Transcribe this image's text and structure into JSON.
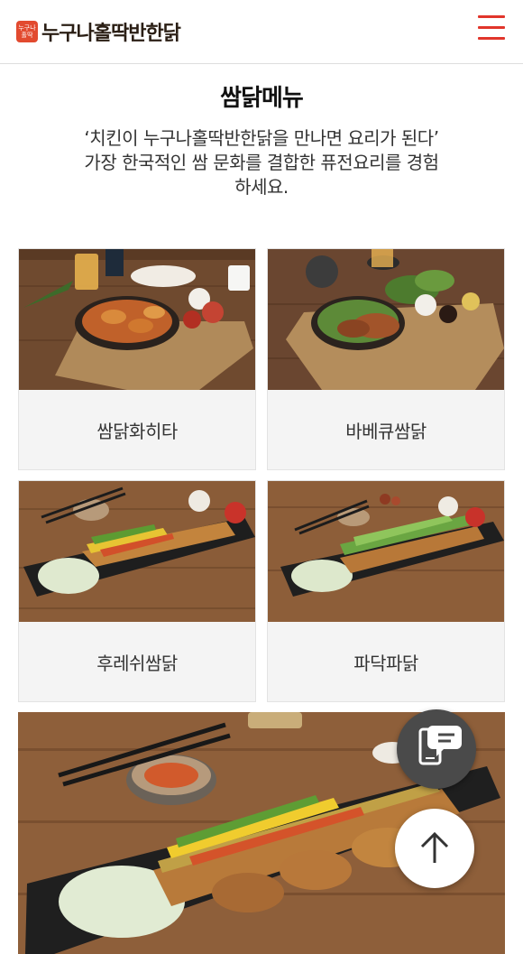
{
  "header": {
    "logo_badge": "누구나 홀딱",
    "logo_text": "누구나홀딱반한닭",
    "menu_icon": "hamburger-icon"
  },
  "main": {
    "title": "쌈닭메뉴",
    "description_line1": "‘치킨이 누구나홀딱반한닭을 만나면 요리가 된다’",
    "description_line2": "가장 한국적인 쌈 문화를 결합한 퓨전요리를 경험",
    "description_line3": "하세요."
  },
  "menu_items": [
    {
      "label": "쌈닭화히타"
    },
    {
      "label": "바베큐쌈닭"
    },
    {
      "label": "후레쉬쌈닭"
    },
    {
      "label": "파닥파닭"
    }
  ],
  "floating": {
    "chat_icon": "chat-phone-icon",
    "top_icon": "arrow-up-icon"
  },
  "colors": {
    "accent": "#e1352b",
    "card_bg": "#f4f4f4",
    "wood": "#7a5234"
  }
}
